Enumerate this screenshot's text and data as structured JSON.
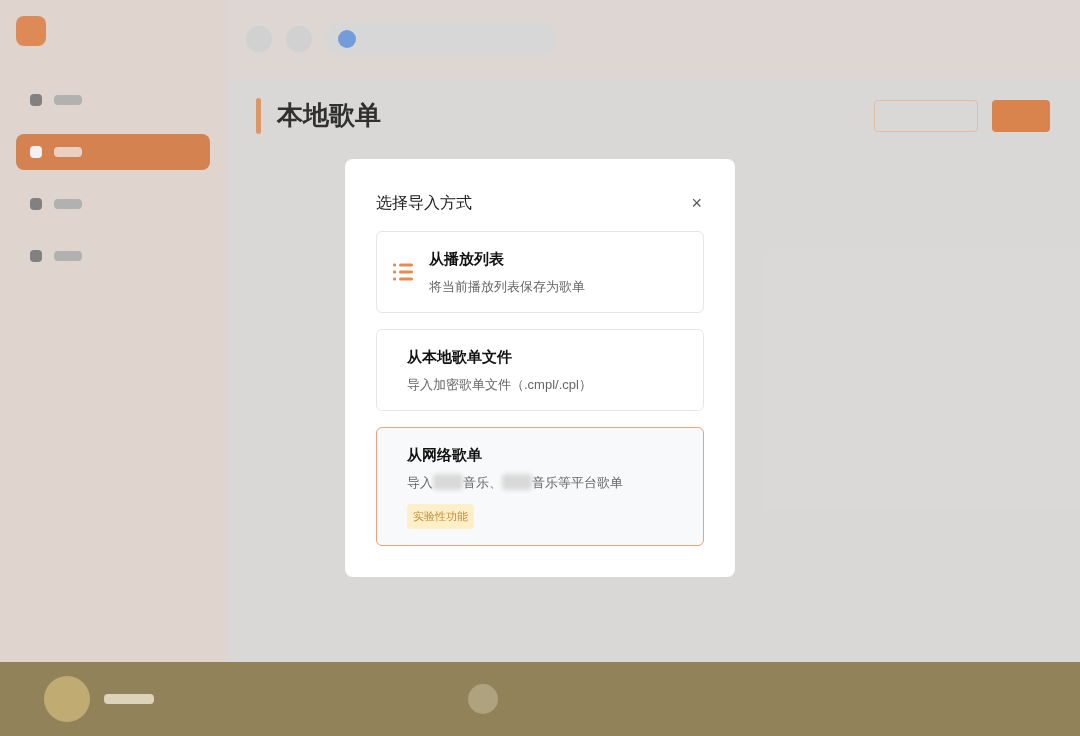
{
  "background": {
    "heading": "本地歌单",
    "nav_items": [
      {
        "selected": false
      },
      {
        "selected": true
      },
      {
        "selected": false
      },
      {
        "selected": false
      }
    ]
  },
  "dialog": {
    "title": "选择导入方式",
    "close": "×",
    "options": [
      {
        "kind": "with_icon",
        "selected": false,
        "title": "从播放列表",
        "description": [
          {
            "kind": "text",
            "text": "将当前播放列表保存为歌单"
          }
        ]
      },
      {
        "kind": "plain",
        "selected": false,
        "title": "从本地歌单文件",
        "description": [
          {
            "kind": "text",
            "text": "导入加密歌单文件（.cmpl/.cpl）"
          }
        ]
      },
      {
        "kind": "plain",
        "selected": true,
        "title": "从网络歌单",
        "description": [
          {
            "kind": "text",
            "text": "导入"
          },
          {
            "kind": "redacted"
          },
          {
            "kind": "text",
            "text": "音乐、"
          },
          {
            "kind": "redacted"
          },
          {
            "kind": "text",
            "text": "音乐等平台歌单"
          }
        ],
        "badge": "实验性功能"
      }
    ]
  }
}
